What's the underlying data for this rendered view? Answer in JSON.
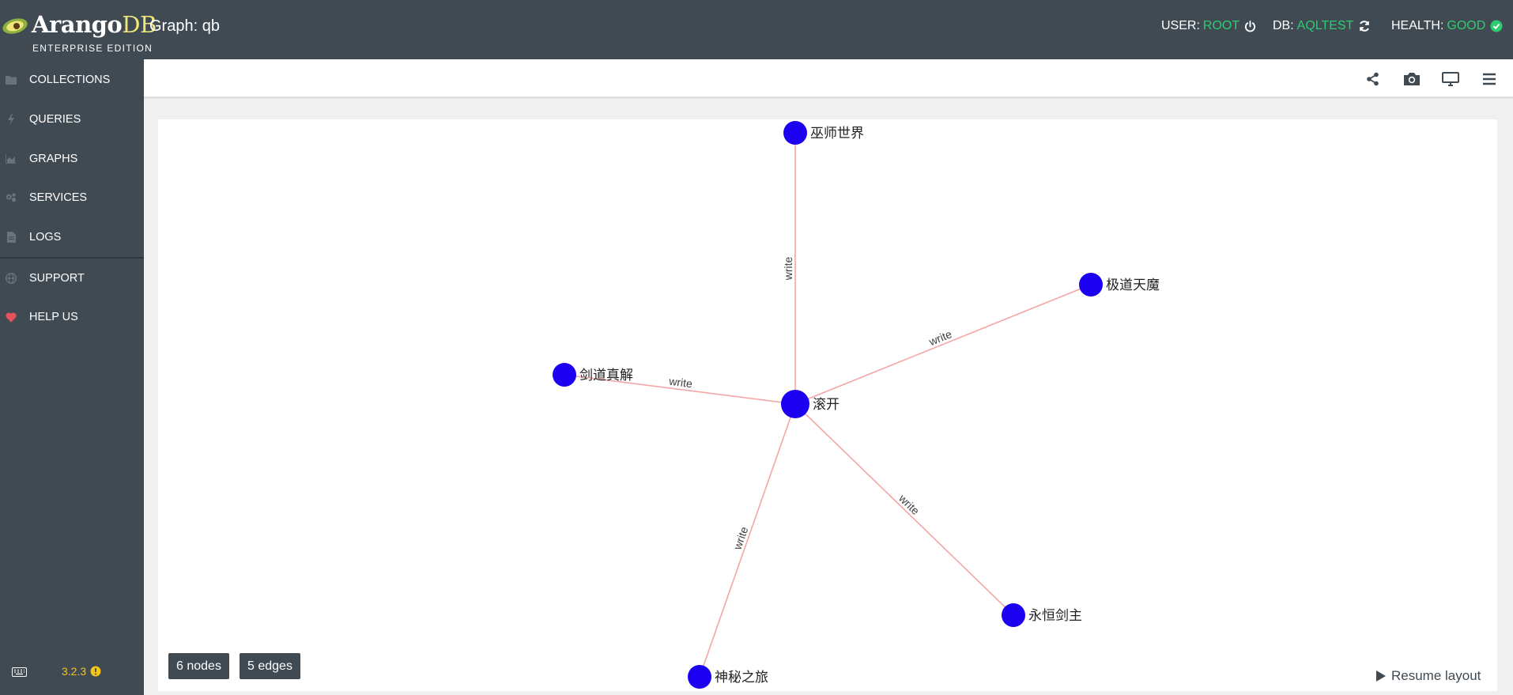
{
  "header": {
    "logo_brand": "Arango",
    "logo_db": "DB",
    "edition": "ENTERPRISE EDITION",
    "graph_title": "Graph: qb",
    "user_label": "USER:",
    "user_value": "ROOT",
    "db_label": "DB:",
    "db_value": "AQLTEST",
    "health_label": "HEALTH:",
    "health_value": "GOOD",
    "accent": "#2ecc71"
  },
  "sidebar": {
    "items": [
      {
        "label": "COLLECTIONS",
        "icon": "folder-icon"
      },
      {
        "label": "QUERIES",
        "icon": "bolt-icon"
      },
      {
        "label": "GRAPHS",
        "icon": "area-chart-icon"
      },
      {
        "label": "SERVICES",
        "icon": "cogs-icon"
      },
      {
        "label": "LOGS",
        "icon": "file-icon"
      },
      {
        "label": "SUPPORT",
        "icon": "globe-icon"
      },
      {
        "label": "HELP US",
        "icon": "heart-icon"
      }
    ],
    "version": "3.2.3"
  },
  "toolbar": {
    "buttons": [
      "share-icon",
      "camera-icon",
      "desktop-icon",
      "menu-icon"
    ]
  },
  "graph": {
    "node_color": "#1c00f0",
    "edge_color": "#f4a6a6",
    "nodes": [
      {
        "id": "center",
        "label": "滚开"
      },
      {
        "id": "n1",
        "label": "巫师世界"
      },
      {
        "id": "n2",
        "label": "极道天魔"
      },
      {
        "id": "n3",
        "label": "剑道真解"
      },
      {
        "id": "n4",
        "label": "永恒剑主"
      },
      {
        "id": "n5",
        "label": "神秘之旅"
      }
    ],
    "edges": [
      {
        "from": "center",
        "to": "n1",
        "label": "write"
      },
      {
        "from": "center",
        "to": "n2",
        "label": "write"
      },
      {
        "from": "center",
        "to": "n3",
        "label": "write"
      },
      {
        "from": "center",
        "to": "n4",
        "label": "write"
      },
      {
        "from": "center",
        "to": "n5",
        "label": "write"
      }
    ],
    "nodes_badge": "6 nodes",
    "edges_badge": "5 edges",
    "resume_label": "Resume layout"
  }
}
